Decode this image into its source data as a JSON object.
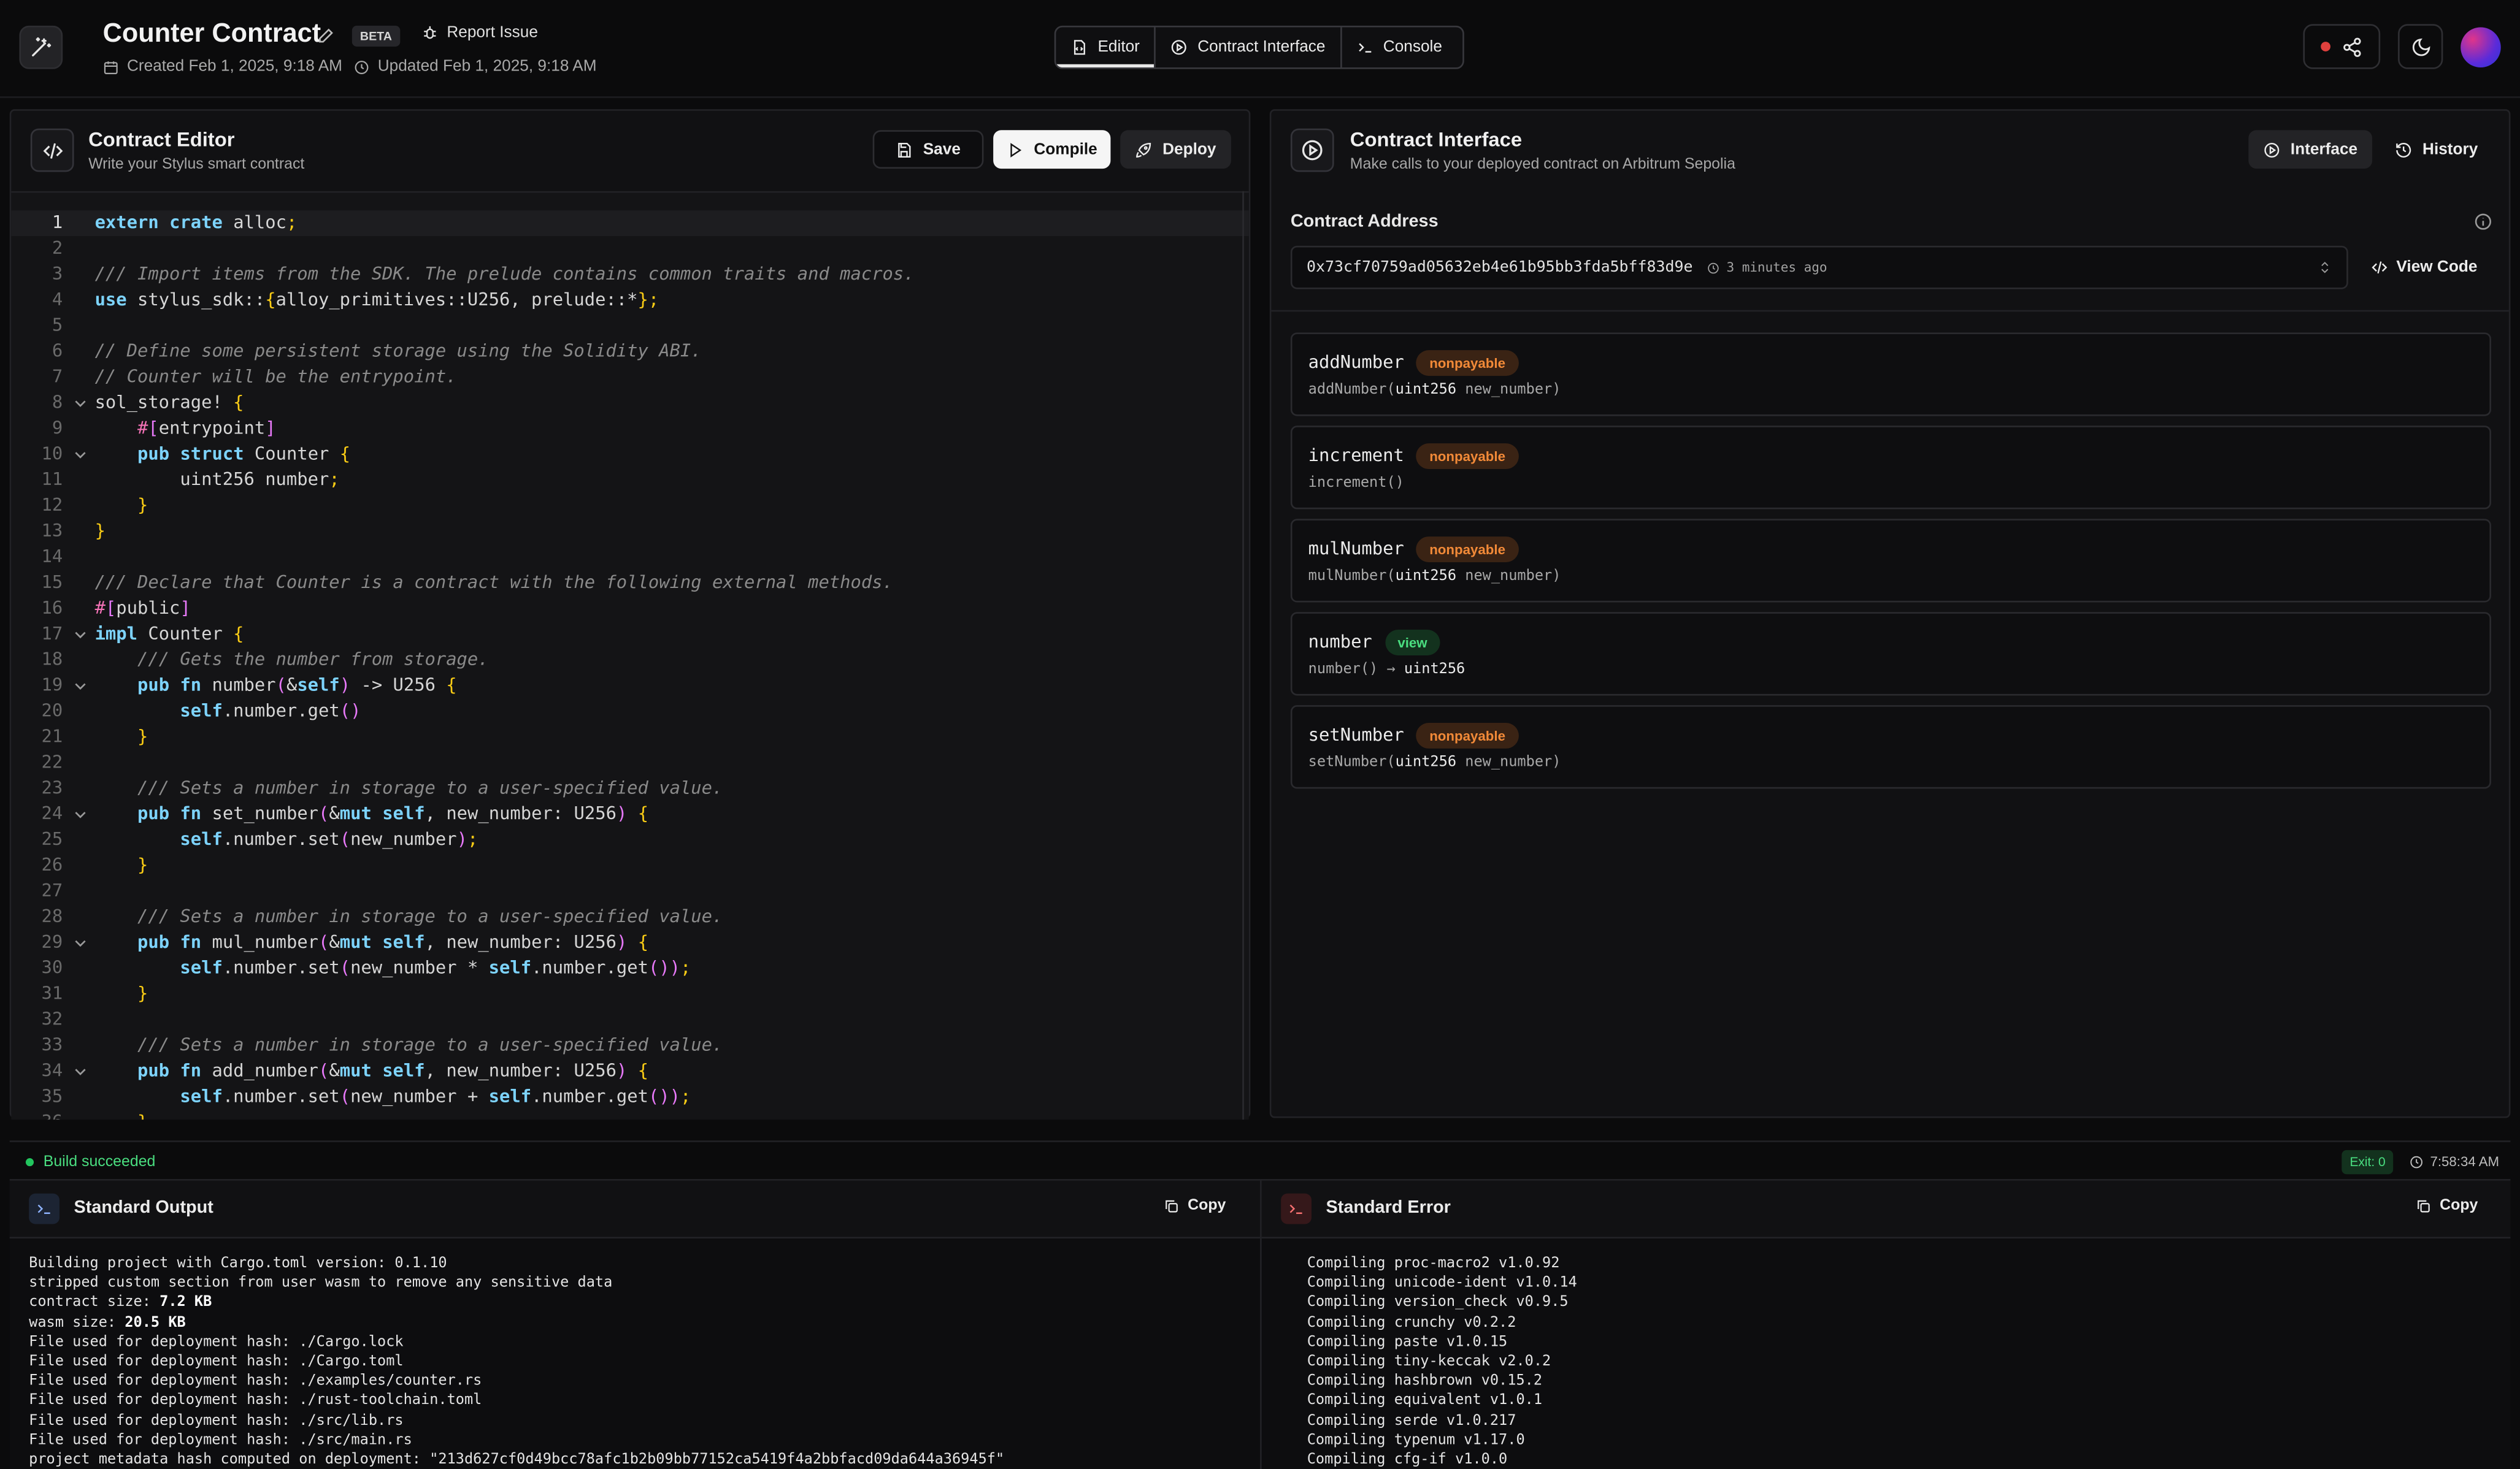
{
  "header": {
    "title": "Counter Contract",
    "beta": "BETA",
    "report_issue": "Report Issue",
    "created": "Created Feb 1, 2025, 9:18 AM",
    "updated": "Updated Feb 1, 2025, 9:18 AM",
    "tabs": [
      {
        "label": "Editor",
        "icon": "code-file-icon",
        "active": true
      },
      {
        "label": "Contract Interface",
        "icon": "play-circle-icon",
        "active": false
      },
      {
        "label": "Console",
        "icon": "terminal-icon",
        "active": false
      }
    ]
  },
  "editor": {
    "title": "Contract Editor",
    "subtitle": "Write your Stylus smart contract",
    "save": "Save",
    "compile": "Compile",
    "deploy": "Deploy",
    "lines": [
      "extern crate alloc;",
      "",
      "/// Import items from the SDK. The prelude contains common traits and macros.",
      "use stylus_sdk::{alloy_primitives::U256, prelude::*};",
      "",
      "// Define some persistent storage using the Solidity ABI.",
      "// Counter will be the entrypoint.",
      "sol_storage! {",
      "    #[entrypoint]",
      "    pub struct Counter {",
      "        uint256 number;",
      "    }",
      "}",
      "",
      "/// Declare that Counter is a contract with the following external methods.",
      "#[public]",
      "impl Counter {",
      "    /// Gets the number from storage.",
      "    pub fn number(&self) -> U256 {",
      "        self.number.get()",
      "    }",
      "",
      "    /// Sets a number in storage to a user-specified value.",
      "    pub fn set_number(&mut self, new_number: U256) {",
      "        self.number.set(new_number);",
      "    }",
      "",
      "    /// Sets a number in storage to a user-specified value.",
      "    pub fn mul_number(&mut self, new_number: U256) {",
      "        self.number.set(new_number * self.number.get());",
      "    }",
      "",
      "    /// Sets a number in storage to a user-specified value.",
      "    pub fn add_number(&mut self, new_number: U256) {",
      "        self.number.set(new_number + self.number.get());",
      "    }"
    ],
    "fold_lines": [
      8,
      10,
      17,
      19,
      24,
      29,
      34
    ],
    "current_line": 1
  },
  "interface": {
    "title": "Contract Interface",
    "subtitle": "Make calls to your deployed contract on Arbitrum Sepolia",
    "tab_interface": "Interface",
    "tab_history": "History",
    "address_label": "Contract Address",
    "address": "0x73cf70759ad05632eb4e61b95bb3fda5bff83d9e",
    "address_age": "3 minutes ago",
    "view_code": "View Code",
    "functions": [
      {
        "name": "addNumber",
        "badge": "nonpayable",
        "sig_name": "addNumber(",
        "sig_type": "uint256",
        "sig_rest": " new_number)"
      },
      {
        "name": "increment",
        "badge": "nonpayable",
        "sig_name": "increment()",
        "sig_type": "",
        "sig_rest": ""
      },
      {
        "name": "mulNumber",
        "badge": "nonpayable",
        "sig_name": "mulNumber(",
        "sig_type": "uint256",
        "sig_rest": " new_number)"
      },
      {
        "name": "number",
        "badge": "view",
        "sig_name": "number() → ",
        "sig_type": "uint256",
        "sig_rest": ""
      },
      {
        "name": "setNumber",
        "badge": "nonpayable",
        "sig_name": "setNumber(",
        "sig_type": "uint256",
        "sig_rest": " new_number)"
      }
    ]
  },
  "console": {
    "status": "Build succeeded",
    "exit": "Exit: 0",
    "time": "7:58:34 AM",
    "stdout_title": "Standard Output",
    "stderr_title": "Standard Error",
    "copy": "Copy",
    "stdout": [
      "Building project with Cargo.toml version: 0.1.10",
      "stripped custom section from user wasm to remove any sensitive data",
      "contract size: 7.2 KB",
      "wasm size: 20.5 KB",
      "File used for deployment hash: ./Cargo.lock",
      "File used for deployment hash: ./Cargo.toml",
      "File used for deployment hash: ./examples/counter.rs",
      "File used for deployment hash: ./rust-toolchain.toml",
      "File used for deployment hash: ./src/lib.rs",
      "File used for deployment hash: ./src/main.rs",
      "project metadata hash computed on deployment: \"213d627cf0d49bcc78afc1b2b09bb77152ca5419f4a2bbfacd09da644a36945f\""
    ],
    "stderr": [
      "   Compiling proc-macro2 v1.0.92",
      "   Compiling unicode-ident v1.0.14",
      "   Compiling version_check v0.9.5",
      "   Compiling crunchy v0.2.2",
      "   Compiling paste v1.0.15",
      "   Compiling tiny-keccak v2.0.2",
      "   Compiling hashbrown v0.15.2",
      "   Compiling equivalent v1.0.1",
      "   Compiling serde v1.0.217",
      "   Compiling typenum v1.17.0",
      "   Compiling cfg-if v1.0.0"
    ]
  }
}
